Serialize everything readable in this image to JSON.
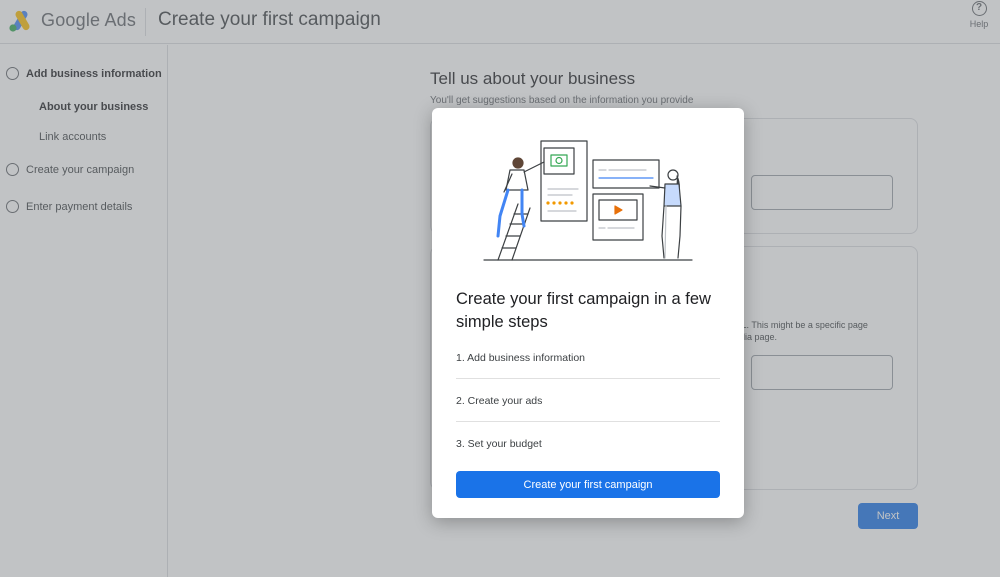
{
  "header": {
    "brand": "Google Ads",
    "title": "Create your first campaign",
    "help_label": "Help",
    "help_glyph": "?"
  },
  "sidebar": {
    "steps": [
      {
        "label": "Add business information",
        "substeps": [
          "About your business",
          "Link accounts"
        ]
      },
      {
        "label": "Create your campaign"
      },
      {
        "label": "Enter payment details"
      }
    ]
  },
  "main": {
    "heading": "Tell us about your business",
    "subheading": "You'll get suggestions based on the information you provide",
    "helper_text_line1": "RL. This might be a specific page",
    "helper_text_line2": "edia page.",
    "next_label": "Next"
  },
  "modal": {
    "title": "Create your first campaign in a few simple steps",
    "steps": [
      "1. Add business information",
      "2. Create your ads",
      "3. Set your budget"
    ],
    "cta_label": "Create your first campaign"
  },
  "colors": {
    "primary": "#1a73e8",
    "logo_blue": "#4285f4",
    "logo_yellow": "#fbbc04",
    "logo_green": "#34a853",
    "star_orange": "#f29900",
    "play_orange": "#e8710a",
    "illustration_green": "#34a853"
  }
}
